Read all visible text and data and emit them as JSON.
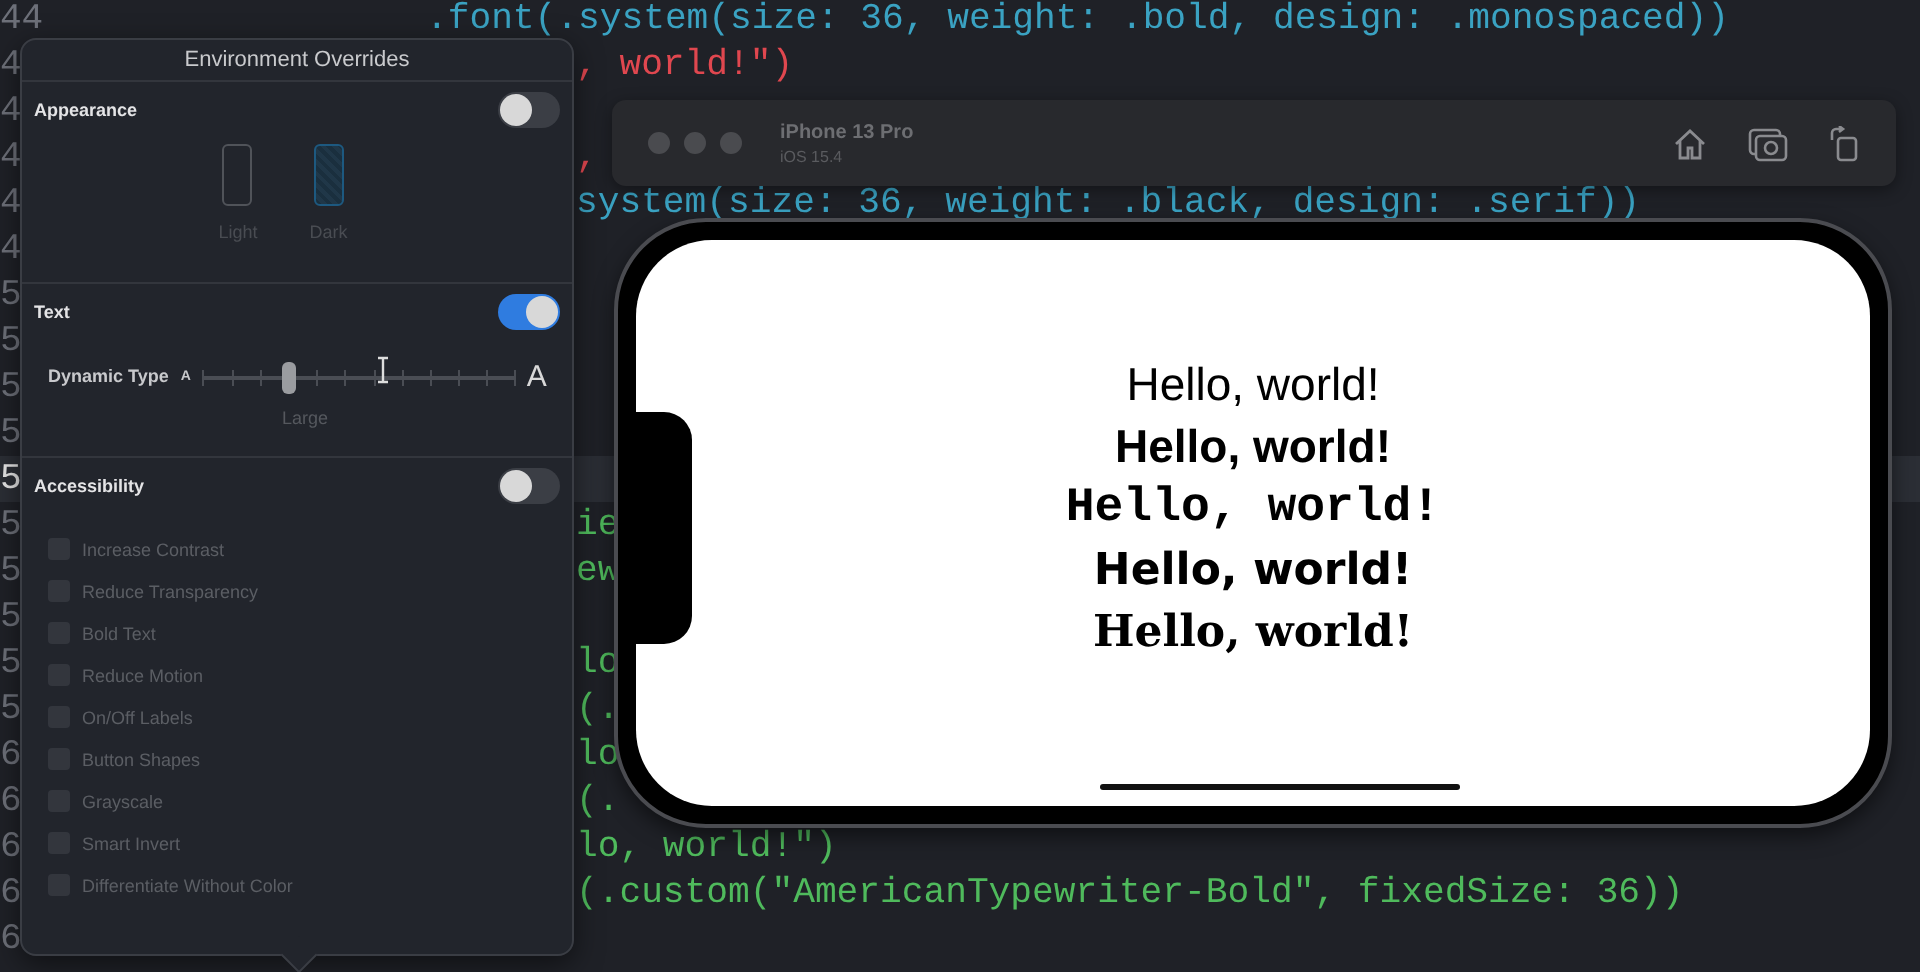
{
  "editor": {
    "lines": [
      {
        "number": "44",
        "code": ".font(.system(size: 36, weight: .bold, design: .monospaced))",
        "kind": "call",
        "current": false
      },
      {
        "number": "4",
        "code": ", world!\")",
        "kind": "string",
        "current": false
      },
      {
        "number": "4",
        "current": false
      },
      {
        "number": "4",
        "code": ",",
        "kind": "string",
        "current": false
      },
      {
        "number": "4",
        "code": "system(size: 36, weight: .black, design: .serif))",
        "kind": "call",
        "current": false
      },
      {
        "number": "4",
        "current": false
      },
      {
        "number": "5",
        "current": false
      },
      {
        "number": "5",
        "current": false
      },
      {
        "number": "5",
        "current": false
      },
      {
        "number": "5",
        "current": false
      },
      {
        "number": "5",
        "current": true
      },
      {
        "number": "5",
        "code": "ie",
        "kind": "modifier",
        "current": false
      },
      {
        "number": "5",
        "code": "ew",
        "kind": "modifier",
        "current": false
      },
      {
        "number": "5",
        "current": false
      },
      {
        "number": "5",
        "code": "lo",
        "kind": "modifier",
        "current": false
      },
      {
        "number": "5",
        "code": "(.",
        "kind": "modifier",
        "current": false
      },
      {
        "number": "6",
        "code": "lo",
        "kind": "modifier",
        "current": false
      },
      {
        "number": "6",
        "code": "(.",
        "kind": "modifier",
        "current": false
      },
      {
        "number": "6",
        "code": "lo, world!\")",
        "kind": "modifier",
        "current": false
      },
      {
        "number": "6",
        "code": "(.custom(\"AmericanTypewriter-Bold\", fixedSize: 36))",
        "kind": "modifier",
        "current": false
      },
      {
        "number": "6",
        "current": false
      }
    ]
  },
  "overrides": {
    "title": "Environment Overrides",
    "appearance": {
      "label": "Appearance",
      "on": false,
      "options": [
        {
          "label": "Light",
          "selected": false
        },
        {
          "label": "Dark",
          "selected": true
        }
      ]
    },
    "text": {
      "label": "Text",
      "on": true,
      "slider_label": "Dynamic Type",
      "small_mark": "A",
      "large_mark": "A",
      "level": 0.273,
      "value": "Large"
    },
    "accessibility": {
      "label": "Accessibility",
      "on": false,
      "options": [
        {
          "label": "Increase Contrast",
          "checked": false,
          "disabled": true
        },
        {
          "label": "Reduce Transparency",
          "checked": false,
          "disabled": true
        },
        {
          "label": "Bold Text",
          "checked": false,
          "disabled": true
        },
        {
          "label": "Reduce Motion",
          "checked": false,
          "disabled": true
        },
        {
          "label": "On/Off Labels",
          "checked": false,
          "disabled": true
        },
        {
          "label": "Button Shapes",
          "checked": false,
          "disabled": true
        },
        {
          "label": "Grayscale",
          "checked": false,
          "disabled": true
        },
        {
          "label": "Smart Invert",
          "checked": false,
          "disabled": true
        },
        {
          "label": "Differentiate Without Color",
          "checked": false,
          "disabled": true
        }
      ]
    }
  },
  "simulator": {
    "device": "iPhone 13 Pro",
    "os": "iOS 15.4",
    "preview": [
      {
        "text": "Hello, world!",
        "kind": "regular"
      },
      {
        "text": "Hello, world!",
        "kind": "bold"
      },
      {
        "text": "Hello, world!",
        "kind": "monospaced"
      },
      {
        "text": "Hello, world!",
        "kind": "rounded"
      },
      {
        "text": "Hello, world!",
        "kind": "serif"
      }
    ]
  }
}
